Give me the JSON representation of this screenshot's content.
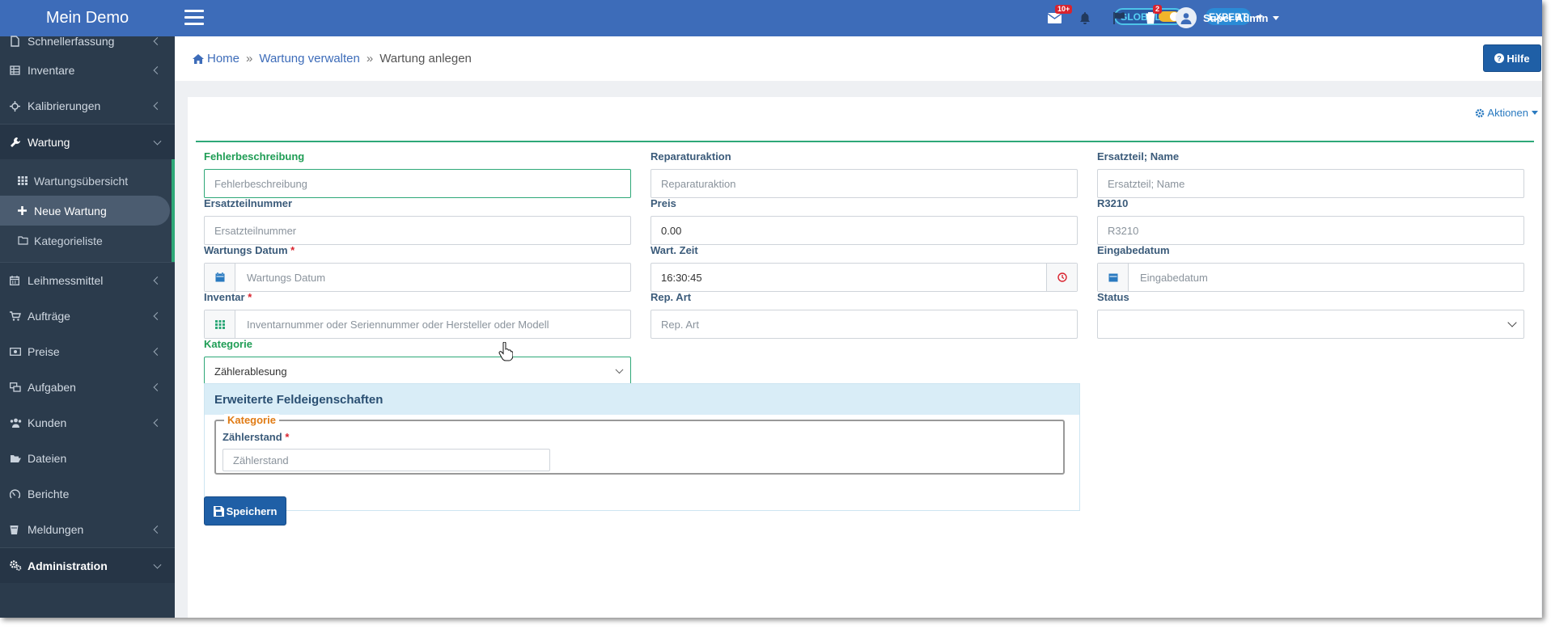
{
  "app": {
    "brand": "Mein Demo"
  },
  "sidebar": {
    "items_top": [
      {
        "label": "Schnellerfassung",
        "icon": "doc-icon"
      },
      {
        "label": "Inventare",
        "icon": "table-icon"
      },
      {
        "label": "Kalibrierungen",
        "icon": "crosshair-icon"
      },
      {
        "label": "Wartung",
        "icon": "wrench-icon"
      }
    ],
    "wartung_sub": [
      {
        "label": "Wartungsübersicht",
        "icon": "grid-icon"
      },
      {
        "label": "Neue Wartung",
        "icon": "plus-icon"
      },
      {
        "label": "Kategorieliste",
        "icon": "folder-icon"
      }
    ],
    "items_bottom": [
      {
        "label": "Leihmessmittel",
        "icon": "calendar-icon"
      },
      {
        "label": "Aufträge",
        "icon": "cart-icon"
      },
      {
        "label": "Preise",
        "icon": "money-icon"
      },
      {
        "label": "Aufgaben",
        "icon": "tasks-icon"
      },
      {
        "label": "Kunden",
        "icon": "users-icon"
      },
      {
        "label": "Dateien",
        "icon": "folder-open-icon"
      },
      {
        "label": "Berichte",
        "icon": "gauge-icon"
      },
      {
        "label": "Meldungen",
        "icon": "bucket-icon"
      },
      {
        "label": "Administration",
        "icon": "cogs-icon"
      }
    ]
  },
  "topbar": {
    "global_label": "GLOBAL",
    "expert_label": "EXPERT",
    "mail_badge": "10+",
    "tasks_badge": "2",
    "user_name": "Super Admin"
  },
  "breadcrumb": {
    "home": "Home",
    "level1": "Wartung verwalten",
    "current": "Wartung anlegen",
    "sep": "»"
  },
  "buttons": {
    "hilfe": "Hilfe",
    "aktionen": "Aktionen",
    "save": "Speichern"
  },
  "form": {
    "fehlerbeschreibung": {
      "label": "Fehlerbeschreibung",
      "placeholder": "Fehlerbeschreibung"
    },
    "reparaturaktion": {
      "label": "Reparaturaktion",
      "placeholder": "Reparaturaktion"
    },
    "ersatzteil_name": {
      "label": "Ersatzteil; Name",
      "placeholder": "Ersatzteil; Name"
    },
    "ersatzteilnummer": {
      "label": "Ersatzteilnummer",
      "placeholder": "Ersatzteilnummer"
    },
    "preis": {
      "label": "Preis",
      "value": "0.00"
    },
    "r3210": {
      "label": "R3210",
      "placeholder": "R3210"
    },
    "wartungs_datum": {
      "label": "Wartungs Datum",
      "placeholder": "Wartungs Datum"
    },
    "wart_zeit": {
      "label": "Wart. Zeit",
      "value": "16:30:45"
    },
    "eingabedatum": {
      "label": "Eingabedatum",
      "placeholder": "Eingabedatum"
    },
    "inventar": {
      "label": "Inventar",
      "placeholder": "Inventarnummer oder Seriennummer oder Hersteller oder Modell"
    },
    "rep_art": {
      "label": "Rep. Art",
      "placeholder": "Rep. Art"
    },
    "status": {
      "label": "Status",
      "value": ""
    },
    "kategorie": {
      "label": "Kategorie",
      "value": "Zählerablesung"
    },
    "required_mark": "*"
  },
  "extended": {
    "title": "Erweiterte Feldeigenschaften",
    "legend": "Kategorie",
    "zaehlerstand": {
      "label": "Zählerstand",
      "placeholder": "Zählerstand"
    }
  },
  "colors": {
    "topbar": "#3d6cb9",
    "sidebar": "#2b3b4c",
    "accent_green": "#2ea878",
    "button_blue": "#1f5fa6",
    "required": "#d9232e"
  }
}
